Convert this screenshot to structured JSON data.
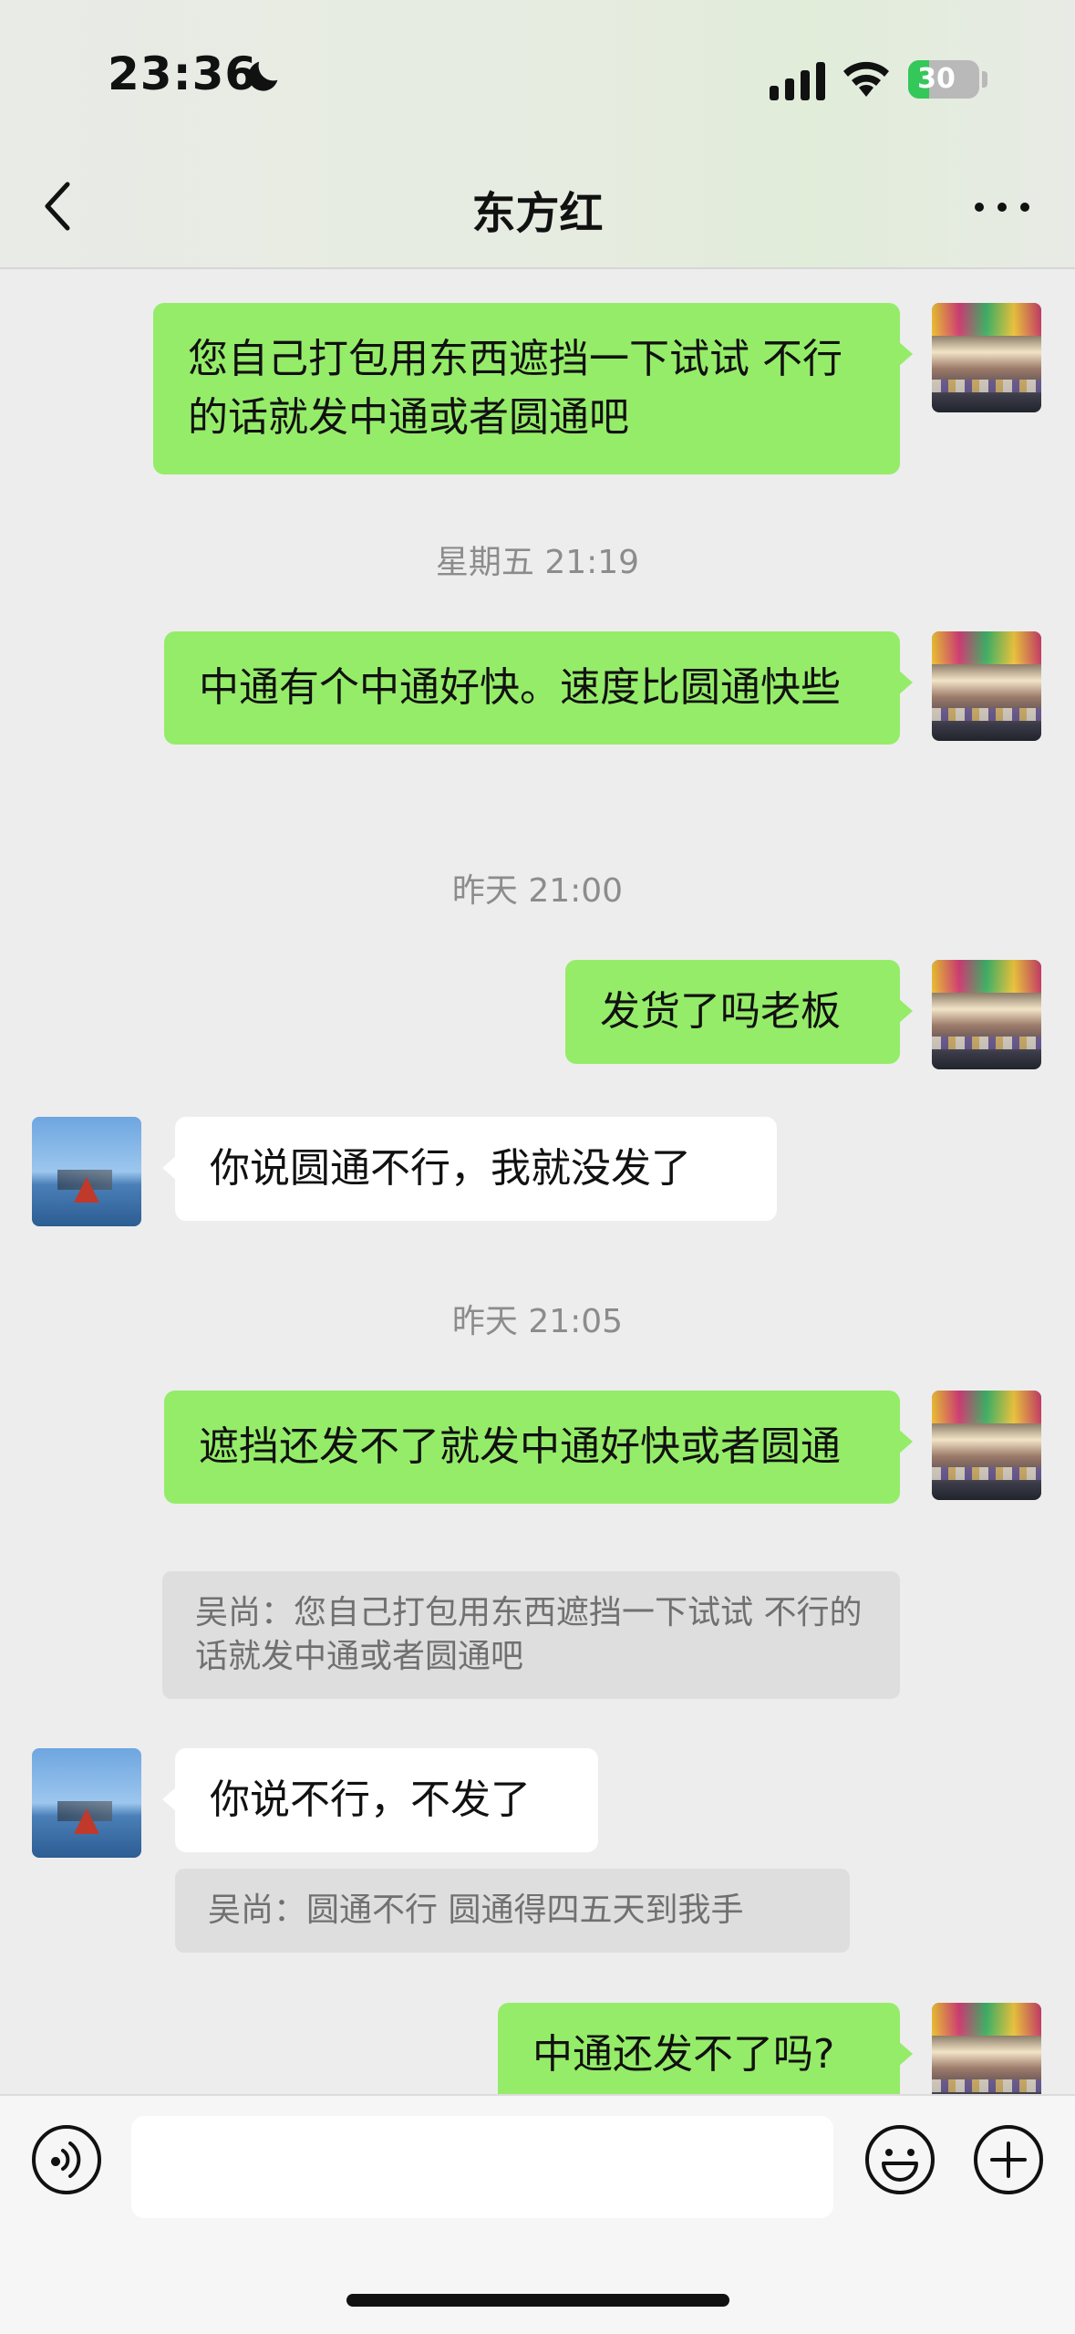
{
  "status_bar": {
    "time": "23:36",
    "battery": "30",
    "battery_level": 0.3,
    "icons": [
      "moon-icon",
      "cellular-signal-icon",
      "wifi-icon",
      "battery-charging-icon"
    ]
  },
  "header": {
    "title": "东方红",
    "back_icon": "chevron-left-icon",
    "more_icon": "more-dots-icon"
  },
  "messages": [
    {
      "type": "sent",
      "text": "您自己打包用东西遮挡一下试试 不行的话就发中通或者圆通吧"
    },
    {
      "type": "time",
      "text": "星期五 21:19"
    },
    {
      "type": "sent",
      "text": "中通有个中通好快。速度比圆通快些"
    },
    {
      "type": "time",
      "text": "昨天 21:00"
    },
    {
      "type": "sent",
      "text": "发货了吗老板"
    },
    {
      "type": "received",
      "text": "你说圆通不行，我就没发了"
    },
    {
      "type": "time",
      "text": "昨天 21:05"
    },
    {
      "type": "sent",
      "text": "遮挡还发不了就发中通好快或者圆通",
      "quote": "吴尚：您自己打包用东西遮挡一下试试 不行的话就发中通或者圆通吧"
    },
    {
      "type": "received",
      "text": "你说不行，不发了",
      "quote": "吴尚：圆通不行 圆通得四五天到我手"
    },
    {
      "type": "sent",
      "text": "中通还发不了吗?"
    }
  ],
  "input_bar": {
    "placeholder": "",
    "icons": [
      "voice-icon",
      "emoji-icon",
      "plus-icon"
    ]
  },
  "colors": {
    "sent_bubble": "#95ec69",
    "received_bubble": "#ffffff",
    "background": "#ededed",
    "battery": "#34c759"
  }
}
